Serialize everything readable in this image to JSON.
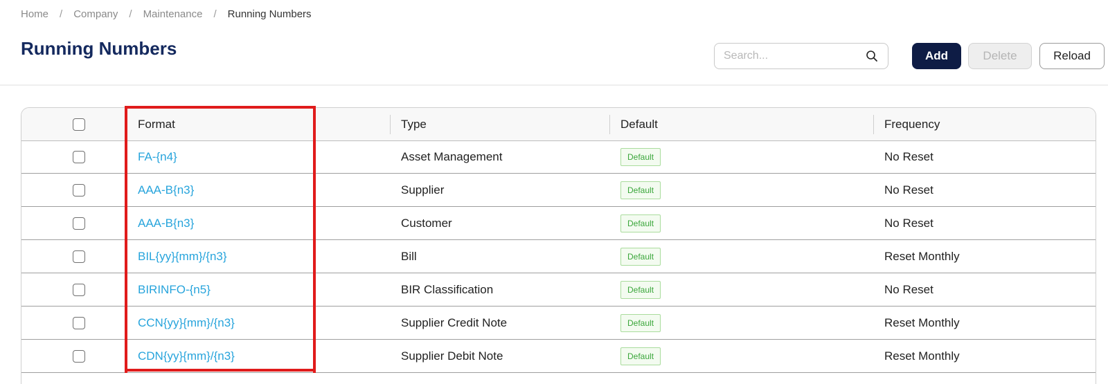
{
  "breadcrumb": {
    "items": [
      "Home",
      "Company",
      "Maintenance"
    ],
    "current": "Running Numbers",
    "separator": "/"
  },
  "page": {
    "title": "Running Numbers"
  },
  "toolbar": {
    "search_placeholder": "Search...",
    "add_label": "Add",
    "delete_label": "Delete",
    "reload_label": "Reload"
  },
  "table": {
    "columns": {
      "format": "Format",
      "type": "Type",
      "default": "Default",
      "frequency": "Frequency"
    },
    "rows": [
      {
        "format": "FA-{n4}",
        "type": "Asset Management",
        "default": "Default",
        "frequency": "No Reset"
      },
      {
        "format": "AAA-B{n3}",
        "type": "Supplier",
        "default": "Default",
        "frequency": "No Reset"
      },
      {
        "format": "AAA-B{n3}",
        "type": "Customer",
        "default": "Default",
        "frequency": "No Reset"
      },
      {
        "format": "BIL{yy}{mm}/{n3}",
        "type": "Bill",
        "default": "Default",
        "frequency": "Reset Monthly"
      },
      {
        "format": "BIRINFO-{n5}",
        "type": "BIR Classification",
        "default": "Default",
        "frequency": "No Reset"
      },
      {
        "format": "CCN{yy}{mm}/{n3}",
        "type": "Supplier Credit Note",
        "default": "Default",
        "frequency": "Reset Monthly"
      },
      {
        "format": "CDN{yy}{mm}/{n3}",
        "type": "Supplier Debit Note",
        "default": "Default",
        "frequency": "Reset Monthly"
      }
    ]
  },
  "colors": {
    "title": "#14295e",
    "primary_button": "#0e1c45",
    "link": "#27a4dc",
    "badge_text": "#3aa63a",
    "highlight": "#e01b1b"
  },
  "icons": {
    "search": "search-icon"
  }
}
